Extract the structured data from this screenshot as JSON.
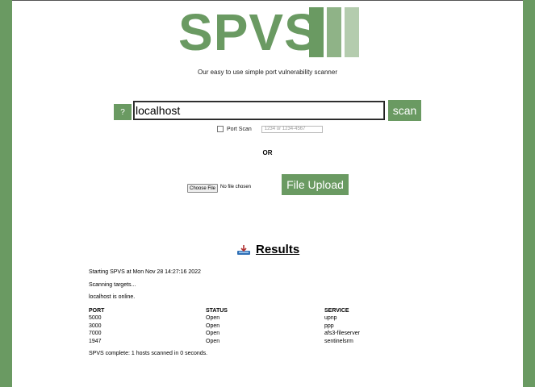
{
  "logo": {
    "text": "SPVS"
  },
  "tagline": "Our easy to use simple port vulnerability scanner",
  "help_button": "?",
  "target_input": {
    "value": "localhost"
  },
  "scan_button": "scan",
  "port_scan": {
    "label": "Port Scan",
    "placeholder": "1234 or 1234-4567",
    "checked": false
  },
  "or_label": "OR",
  "file_input": {
    "button": "Choose File",
    "status": "No file chosen"
  },
  "upload_button": "File Upload",
  "results": {
    "title": "Results",
    "icon": "tray-download-icon",
    "log": [
      "Starting SPVS at Mon Nov 28 14:27:16 2022",
      "Scanning targets...",
      "localhost is online."
    ],
    "table": {
      "headers": [
        "PORT",
        "STATUS",
        "SERVICE"
      ],
      "rows": [
        [
          "5000",
          "Open",
          "upnp"
        ],
        [
          "3000",
          "Open",
          "ppp"
        ],
        [
          "7000",
          "Open",
          "afs3-fileserver"
        ],
        [
          "1947",
          "Open",
          "sentinelsrm"
        ]
      ]
    },
    "summary": "SPVS complete: 1 hosts scanned in 0 seconds."
  },
  "colors": {
    "brand": "#6a9a62",
    "brand_mid": "#8fb387",
    "brand_light": "#b4ccae",
    "page_bg": "#ffffff"
  }
}
